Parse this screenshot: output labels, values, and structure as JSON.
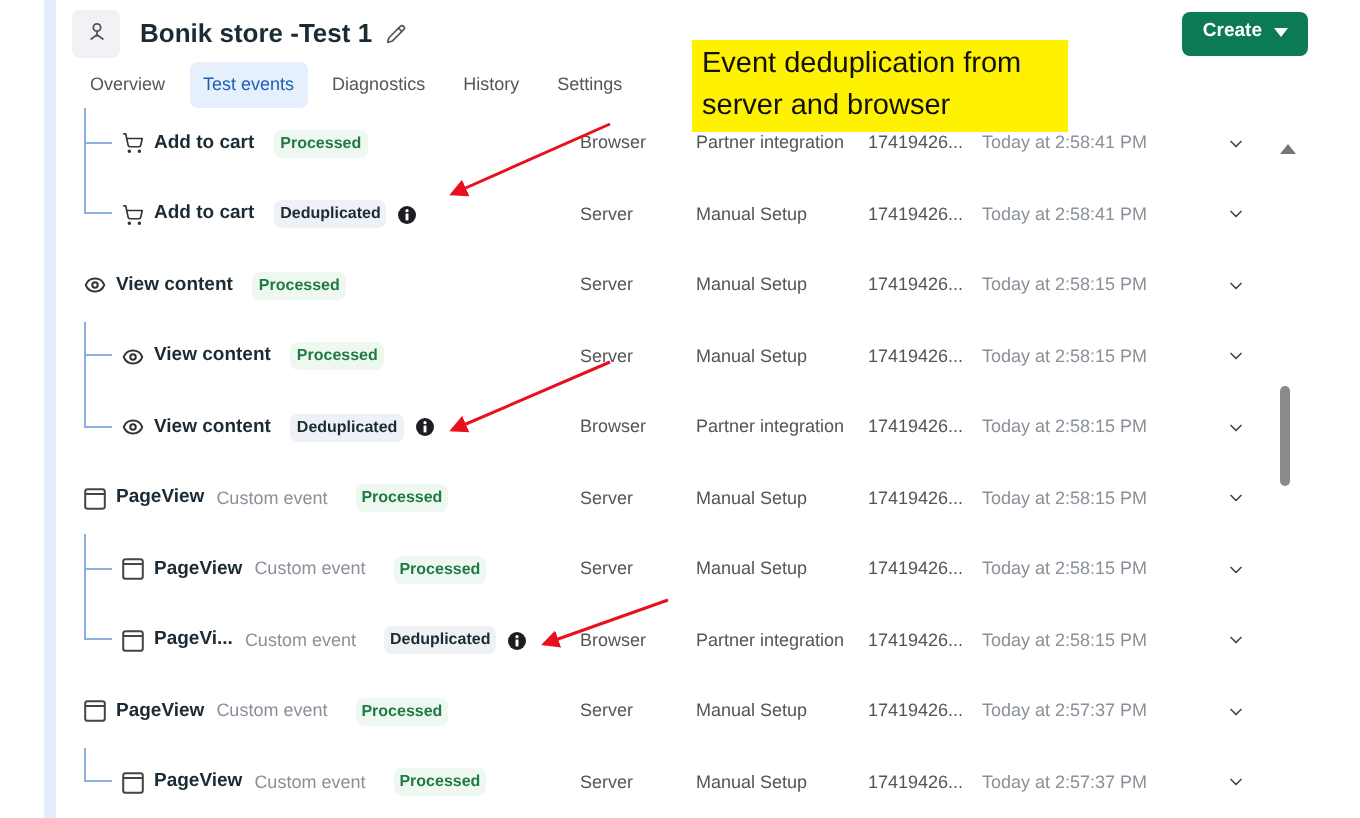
{
  "header": {
    "title": "Bonik store -Test 1",
    "create_button": "Create"
  },
  "tabs": [
    {
      "label": "Overview",
      "selected": false
    },
    {
      "label": "Test events",
      "selected": true
    },
    {
      "label": "Diagnostics",
      "selected": false
    },
    {
      "label": "History",
      "selected": false
    },
    {
      "label": "Settings",
      "selected": false
    }
  ],
  "events": [
    {
      "children": [
        {
          "kind": "cart",
          "name": "Add to cart",
          "status": {
            "label": "Processed",
            "kind": "processed"
          },
          "source": "Browser",
          "setup": "Partner integration",
          "id": "17419426...",
          "time": "Today at 2:58:41 PM"
        },
        {
          "kind": "cart",
          "name": "Add to cart",
          "status": {
            "label": "Deduplicated",
            "kind": "deduplicated"
          },
          "source": "Server",
          "setup": "Manual Setup",
          "id": "17419426...",
          "time": "Today at 2:58:41 PM"
        }
      ]
    },
    {
      "kind": "eye",
      "name": "View content",
      "status": {
        "label": "Processed",
        "kind": "processed"
      },
      "source": "Server",
      "setup": "Manual Setup",
      "id": "17419426...",
      "time": "Today at 2:58:15 PM",
      "children": [
        {
          "kind": "eye",
          "name": "View content",
          "status": {
            "label": "Processed",
            "kind": "processed"
          },
          "source": "Server",
          "setup": "Manual Setup",
          "id": "17419426...",
          "time": "Today at 2:58:15 PM"
        },
        {
          "kind": "eye",
          "name": "View content",
          "status": {
            "label": "Deduplicated",
            "kind": "deduplicated"
          },
          "source": "Browser",
          "setup": "Partner integration",
          "id": "17419426...",
          "time": "Today at 2:58:15 PM"
        }
      ]
    },
    {
      "kind": "page",
      "name": "PageView",
      "type": "Custom event",
      "status": {
        "label": "Processed",
        "kind": "processed"
      },
      "source": "Server",
      "setup": "Manual Setup",
      "id": "17419426...",
      "time": "Today at 2:58:15 PM",
      "children": [
        {
          "kind": "page",
          "name": "PageView",
          "type": "Custom event",
          "status": {
            "label": "Processed",
            "kind": "processed"
          },
          "source": "Server",
          "setup": "Manual Setup",
          "id": "17419426...",
          "time": "Today at 2:58:15 PM"
        },
        {
          "kind": "page",
          "name": "PageVi...",
          "type": "Custom event",
          "status": {
            "label": "Deduplicated",
            "kind": "deduplicated"
          },
          "source": "Browser",
          "setup": "Partner integration",
          "id": "17419426...",
          "time": "Today at 2:58:15 PM"
        }
      ]
    },
    {
      "kind": "page",
      "name": "PageView",
      "type": "Custom event",
      "status": {
        "label": "Processed",
        "kind": "processed"
      },
      "source": "Server",
      "setup": "Manual Setup",
      "id": "17419426...",
      "time": "Today at 2:57:37 PM",
      "children": [
        {
          "kind": "page",
          "name": "PageView",
          "type": "Custom event",
          "status": {
            "label": "Processed",
            "kind": "processed"
          },
          "source": "Server",
          "setup": "Manual Setup",
          "id": "17419426...",
          "time": "Today at 2:57:37 PM"
        }
      ]
    }
  ],
  "callout": {
    "text": "Event deduplication from server and browser"
  }
}
